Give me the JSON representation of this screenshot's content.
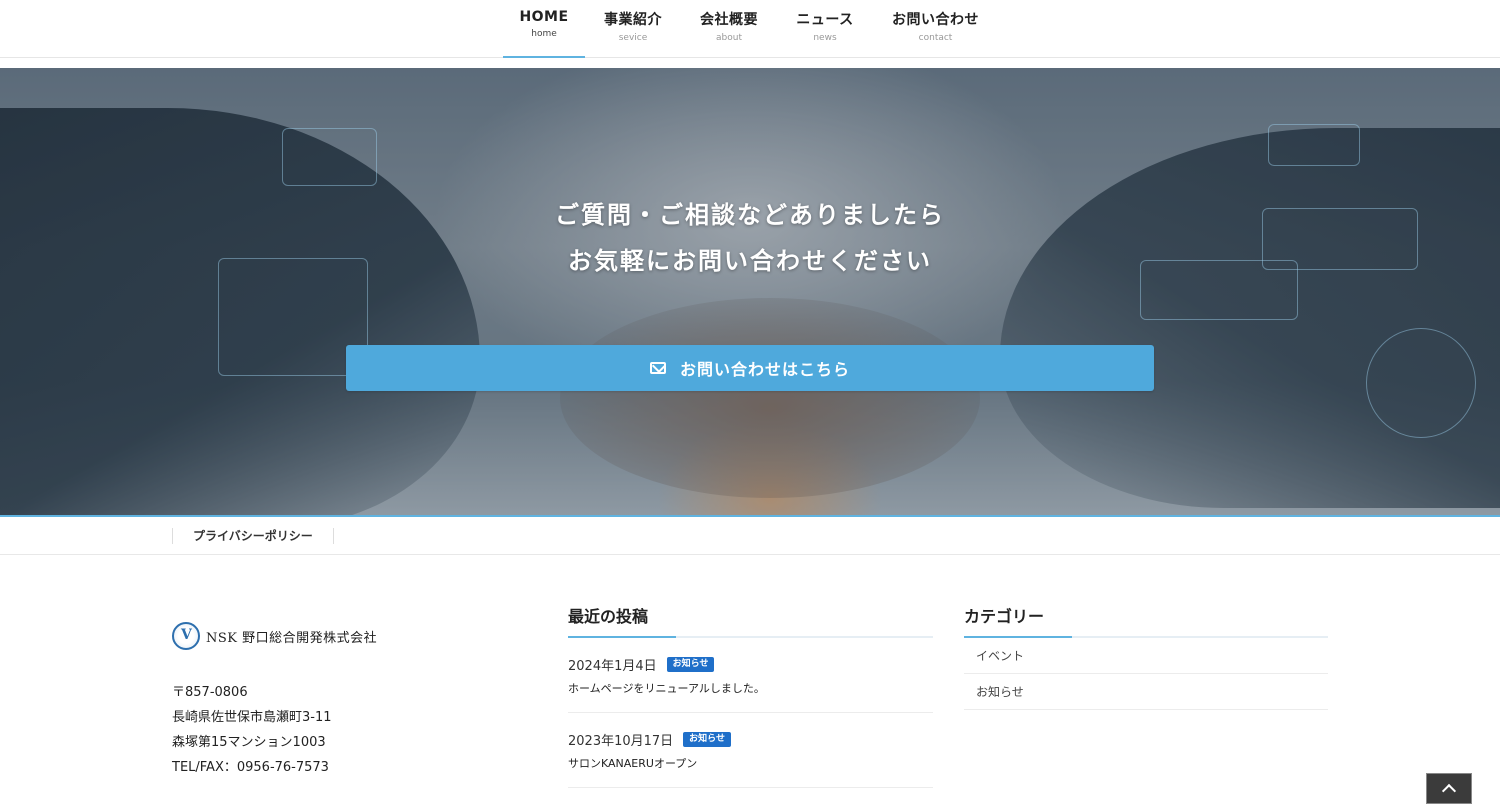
{
  "nav": {
    "items": [
      {
        "main": "HOME",
        "sub": "home",
        "active": true
      },
      {
        "main": "事業紹介",
        "sub": "sevice"
      },
      {
        "main": "会社概要",
        "sub": "about"
      },
      {
        "main": "ニュース",
        "sub": "news"
      },
      {
        "main": "お問い合わせ",
        "sub": "contact"
      }
    ]
  },
  "hero": {
    "line1": "ご質問・ご相談などありましたら",
    "line2": "お気軽にお問い合わせください",
    "cta_label": "お問い合わせはこちら",
    "cta_icon": "mail-icon",
    "accent_color": "#4fa9dc"
  },
  "subnav": {
    "privacy_link": "プライバシーポリシー"
  },
  "company": {
    "logo_text": "NSK 野口総合開発株式会社",
    "postal": "〒857-0806",
    "address1": "長崎県佐世保市島瀬町3-11",
    "address2": "森塚第15マンション1003",
    "tel": "TEL/FAX：0956-76-7573"
  },
  "recent_posts": {
    "title": "最近の投稿",
    "items": [
      {
        "date": "2024年1月4日",
        "badge": "お知らせ",
        "title": "ホームページをリニューアルしました。"
      },
      {
        "date": "2023年10月17日",
        "badge": "お知らせ",
        "title": "サロンKANAERUオープン"
      }
    ]
  },
  "categories": {
    "title": "カテゴリー",
    "items": [
      "イベント",
      "お知らせ"
    ]
  },
  "totop_icon": "chevron-up-icon"
}
